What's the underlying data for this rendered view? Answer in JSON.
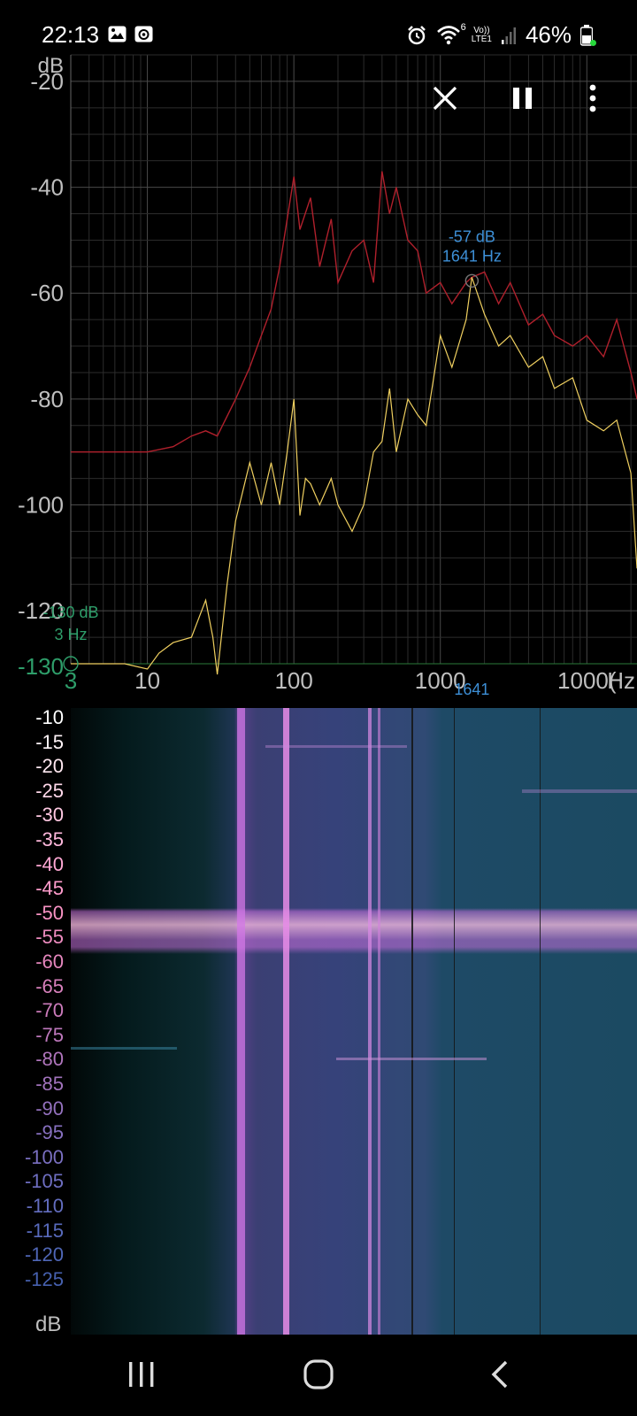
{
  "status_bar": {
    "time": "22:13",
    "network_label_top": "Vo))",
    "network_label_bottom": "LTE1",
    "wifi_tag": "6",
    "battery_percent": "46%",
    "icons": [
      "gallery-icon",
      "screen-record-icon",
      "alarm-icon",
      "wifi-icon",
      "signal-icon",
      "battery-icon"
    ]
  },
  "controls": {
    "close": "close-icon",
    "pause": "pause-icon",
    "more": "more-vert-icon"
  },
  "spectrum": {
    "db_unit": "dB",
    "y_tick_labels": [
      "-20",
      "-40",
      "-60",
      "-80",
      "-100",
      "-120",
      "-130"
    ],
    "x_tick_labels": [
      "3",
      "10",
      "100",
      "1000",
      "10000",
      "Hz"
    ],
    "x_tick_labels_display": [
      "3",
      "10",
      "100",
      "1000",
      "1000(",
      "Hz"
    ],
    "peak_marker": {
      "db": "-57 dB",
      "hz": "1641 Hz",
      "x_readout": "1641"
    },
    "cursor_marker": {
      "db": "-130 dB",
      "hz": "3 Hz"
    },
    "colors": {
      "grid": "#3a3a3a",
      "axis_text": "#bfbfbf",
      "peak_trace": "#b0202c",
      "live_trace": "#f0d060",
      "marker_text": "#3d8fd6",
      "cursor_text": "#2e9e6a"
    }
  },
  "chart_data": {
    "type": "line",
    "title": "",
    "xlabel": "Hz",
    "ylabel": "dB",
    "x_scale": "log",
    "xlim": [
      3,
      22000
    ],
    "ylim": [
      -130,
      -15
    ],
    "grid": true,
    "series": [
      {
        "color": "#b0202c",
        "x": [
          3,
          10,
          15,
          20,
          25,
          30,
          40,
          50,
          60,
          70,
          80,
          90,
          100,
          110,
          130,
          150,
          180,
          200,
          250,
          300,
          350,
          400,
          450,
          500,
          600,
          700,
          800,
          1000,
          1200,
          1500,
          1641,
          2000,
          2500,
          3000,
          4000,
          5000,
          6000,
          8000,
          10000,
          13000,
          16000,
          20000,
          22000
        ],
        "y": [
          -90,
          -90,
          -89,
          -87,
          -86,
          -87,
          -80,
          -74,
          -68,
          -63,
          -55,
          -46,
          -38,
          -48,
          -42,
          -55,
          -46,
          -58,
          -52,
          -50,
          -58,
          -37,
          -45,
          -40,
          -50,
          -52,
          -60,
          -58,
          -62,
          -58,
          -57,
          -56,
          -62,
          -58,
          -66,
          -64,
          -68,
          -70,
          -68,
          -72,
          -65,
          -75,
          -80
        ]
      },
      {
        "color": "#f0d060",
        "x": [
          3,
          7,
          10,
          12,
          15,
          20,
          25,
          28,
          30,
          35,
          40,
          50,
          60,
          70,
          80,
          90,
          100,
          110,
          120,
          130,
          150,
          180,
          200,
          250,
          300,
          350,
          400,
          450,
          500,
          600,
          700,
          800,
          1000,
          1200,
          1500,
          1641,
          2000,
          2500,
          3000,
          4000,
          5000,
          6000,
          8000,
          10000,
          13000,
          16000,
          20000,
          22000
        ],
        "y": [
          -130,
          -130,
          -131,
          -128,
          -126,
          -125,
          -118,
          -125,
          -132,
          -115,
          -103,
          -92,
          -100,
          -92,
          -100,
          -90,
          -80,
          -102,
          -95,
          -96,
          -100,
          -95,
          -100,
          -105,
          -100,
          -90,
          -88,
          -78,
          -90,
          -80,
          -83,
          -85,
          -68,
          -74,
          -65,
          -57,
          -64,
          -70,
          -68,
          -74,
          -72,
          -78,
          -76,
          -84,
          -86,
          -84,
          -94,
          -112
        ]
      }
    ]
  },
  "spectrogram": {
    "db_unit": "dB",
    "scale_labels": [
      "-10",
      "-15",
      "-20",
      "-25",
      "-30",
      "-35",
      "-40",
      "-45",
      "-50",
      "-55",
      "-60",
      "-65",
      "-70",
      "-75",
      "-80",
      "-85",
      "-90",
      "-95",
      "-100",
      "-105",
      "-110",
      "-115",
      "-120",
      "-125"
    ],
    "scale_colors": [
      "#ffffff",
      "#fff4f8",
      "#ffe8f0",
      "#ffd8ea",
      "#ffc8e2",
      "#ffb8dc",
      "#ffa8d4",
      "#ff9ccc",
      "#f993c4",
      "#ef8cc0",
      "#e586bd",
      "#d880bc",
      "#cc7bbb",
      "#be78bc",
      "#b075bc",
      "#a273bd",
      "#9471be",
      "#8770c0",
      "#7a6fc1",
      "#6e6ec1",
      "#636dbf",
      "#586abc",
      "#4f66b6",
      "#4660ae"
    ]
  },
  "nav_bar": {
    "recents": "recents-icon",
    "home": "home-icon",
    "back": "back-icon"
  }
}
